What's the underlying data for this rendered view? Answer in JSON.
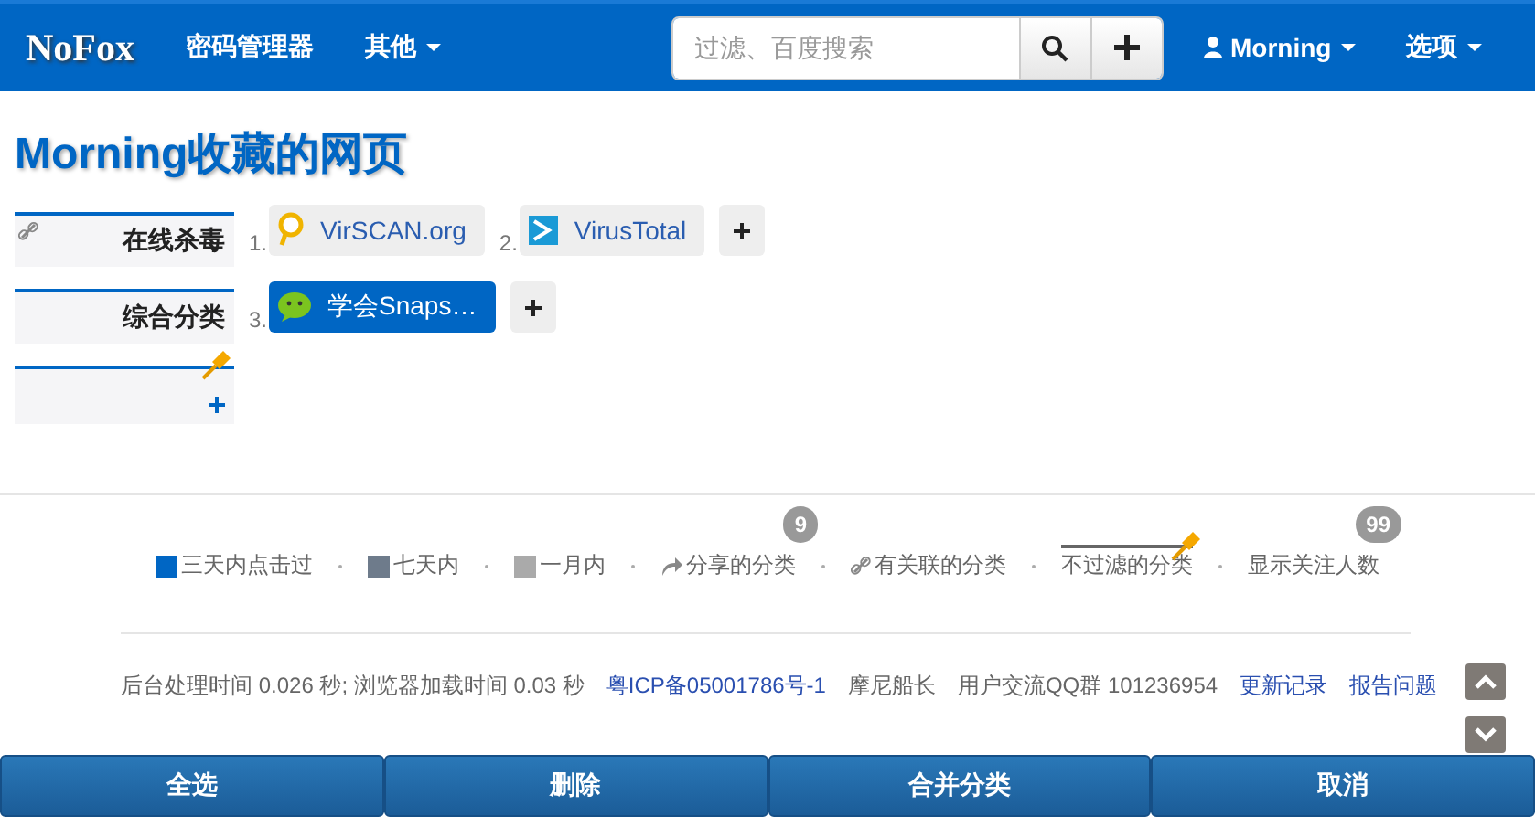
{
  "navbar": {
    "brand": "NoFox",
    "items": [
      {
        "label": "密码管理器",
        "dropdown": false
      },
      {
        "label": "其他",
        "dropdown": true
      }
    ],
    "search": {
      "placeholder": "过滤、百度搜索"
    },
    "user": "Morning",
    "options": "选项"
  },
  "title": "Morning收藏的网页",
  "categories": [
    {
      "kind": "category",
      "name": "在线杀毒",
      "linked": true,
      "links": [
        {
          "number": "1.",
          "label": "VirSCAN.org",
          "recent": false
        },
        {
          "number": "2.",
          "label": "VirusTotal",
          "recent": false
        }
      ]
    },
    {
      "kind": "category",
      "name": "综合分类",
      "linked": false,
      "links": [
        {
          "number": "3.",
          "label": "学会Snaps…",
          "recent": true
        }
      ]
    },
    {
      "kind": "new"
    }
  ],
  "legend": [
    {
      "kind": "swatch",
      "color": "#0066c4",
      "label": "三天内点击过"
    },
    {
      "kind": "swatch",
      "color": "#6e7b8b",
      "label": "七天内"
    },
    {
      "kind": "swatch",
      "color": "#aaaaaa",
      "label": "一月内"
    },
    {
      "kind": "share",
      "label": "分享的分类",
      "badge": "9"
    },
    {
      "kind": "link",
      "label": "有关联的分类"
    },
    {
      "kind": "unfiltered",
      "label": "不过滤的分类"
    },
    {
      "kind": "followers",
      "label": "显示关注人数",
      "badge": "99"
    }
  ],
  "footer": [
    {
      "kind": "text",
      "text": "后台处理时间 0.026 秒; 浏览器加载时间 0.03 秒"
    },
    {
      "kind": "link",
      "text": "粤ICP备05001786号-1"
    },
    {
      "kind": "text",
      "text": "摩尼船长"
    },
    {
      "kind": "text",
      "text": "用户交流QQ群 101236954"
    },
    {
      "kind": "link",
      "text": "更新记录"
    },
    {
      "kind": "link",
      "text": "报告问题"
    }
  ],
  "actions": [
    "全选",
    "删除",
    "合并分类",
    "取消"
  ]
}
